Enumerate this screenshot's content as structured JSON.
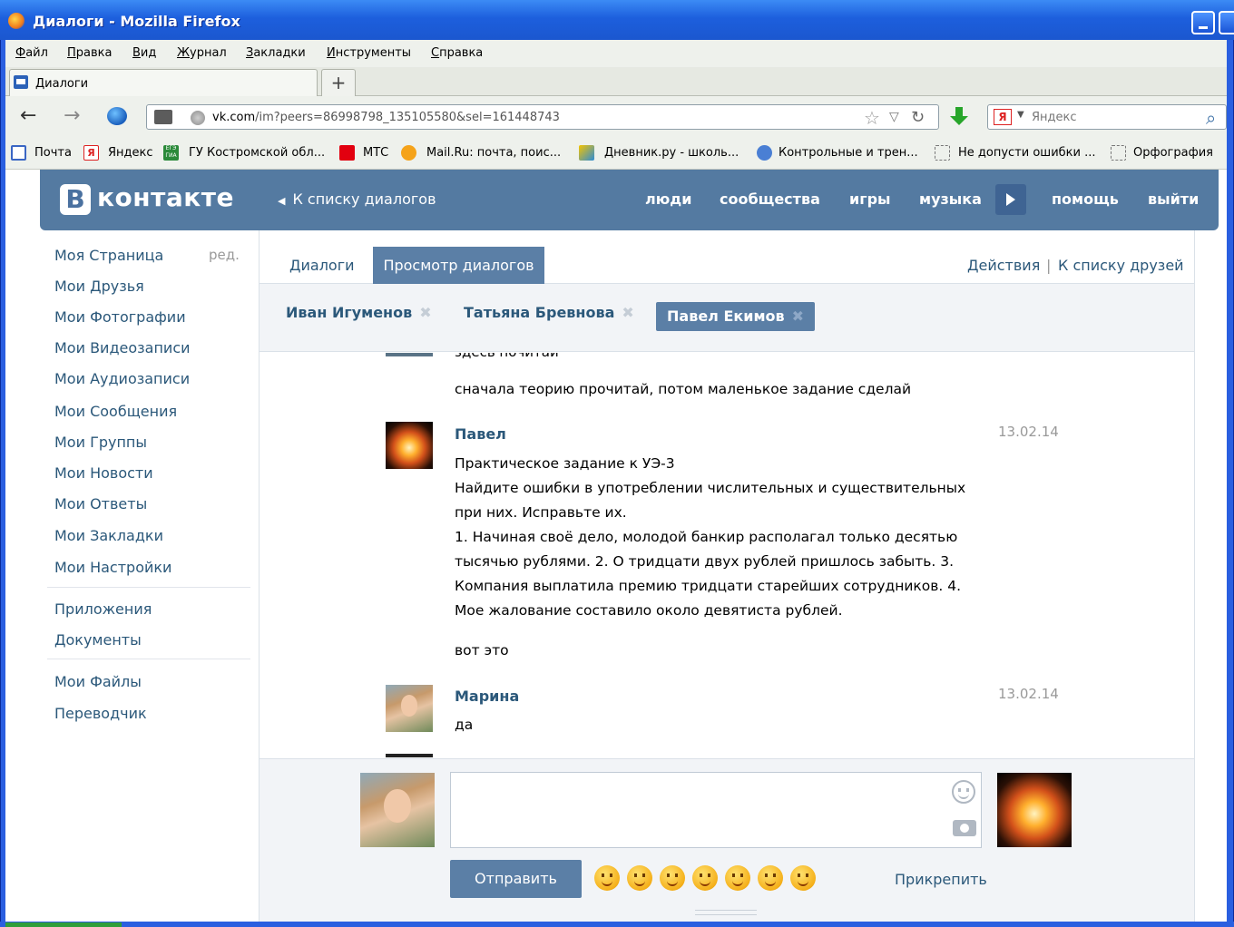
{
  "window": {
    "title": "Диалоги - Mozilla Firefox"
  },
  "menu": [
    "Файл",
    "Правка",
    "Вид",
    "Журнал",
    "Закладки",
    "Инструменты",
    "Справка"
  ],
  "tab": {
    "label": "Диалоги",
    "new_tab": "+"
  },
  "nav": {
    "url_host": "vk.com",
    "url_rest": "/im?peers=86998798_135105580&sel=161448743",
    "search_placeholder": "Яндекс",
    "search_engine_badge": "Я"
  },
  "bookmarks": [
    "Почта",
    "Яндекс",
    "ГУ Костромской обл...",
    "МТС",
    "Mail.Ru: почта, поис...",
    "Дневник.ру - школь...",
    "Контрольные и трен...",
    "Не допусти ошибки ...",
    "Орфография"
  ],
  "bookmark_badges": {
    "yandex": "Я",
    "egegia": "ЕГЭ ГИА"
  },
  "vk": {
    "logo_letter": "B",
    "logo_text": "контакте",
    "back_to_dialogs": "К списку диалогов",
    "nav": [
      "люди",
      "сообщества",
      "игры",
      "музыка",
      "помощь",
      "выйти"
    ]
  },
  "sidebar": {
    "edit": "ред.",
    "group1": [
      "Моя Страница",
      "Мои Друзья",
      "Мои Фотографии",
      "Мои Видеозаписи",
      "Мои Аудиозаписи",
      "Мои Сообщения",
      "Мои Группы",
      "Мои Новости",
      "Мои Ответы",
      "Мои Закладки",
      "Мои Настройки"
    ],
    "group2": [
      "Приложения",
      "Документы"
    ],
    "group3": [
      "Мои Файлы",
      "Переводчик"
    ]
  },
  "tabs": {
    "dialogs": "Диалоги",
    "view": "Просмотр диалогов",
    "actions": "Действия",
    "separator": "|",
    "friends": "К списку друзей"
  },
  "peers": [
    {
      "name": "Иван Игуменов",
      "close": "✖"
    },
    {
      "name": "Татьяна Бревнова",
      "close": "✖"
    },
    {
      "name": "Павел Екимов",
      "close": "✖"
    }
  ],
  "history": {
    "cut_text": "здесь почитай",
    "line0": "сначала теорию прочитай, потом маленькое задание сделай",
    "msg1": {
      "author": "Павел",
      "date": "13.02.14",
      "lines": [
        "Практическое задание к УЭ-3",
        "Найдите ошибки в употреблении числительных и существительных",
        "при них. Исправьте их.",
        "1. Начиная своё дело, молодой банкир располагал только десятью",
        "тысячью рублями. 2. О тридцати двух рублей пришлось забыть. 3.",
        "Компания выплатила премию тридцати старейших сотрудников. 4.",
        "Мое жалование составило около девятиста рублей."
      ],
      "followup": "вот это"
    },
    "msg2": {
      "author": "Марина",
      "date": "13.02.14",
      "text": "да"
    }
  },
  "composer": {
    "send": "Отправить",
    "attach": "Прикрепить"
  }
}
